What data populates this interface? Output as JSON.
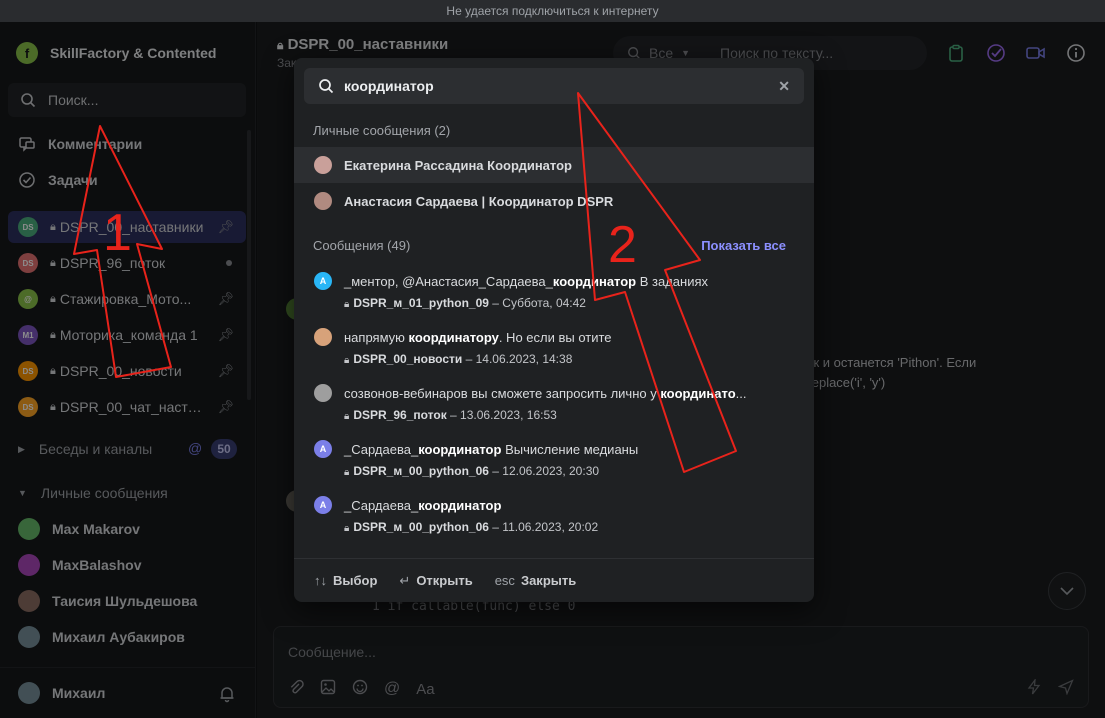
{
  "banner": "Не удается подключиться к интернету",
  "workspace": {
    "name": "SkillFactory & Contented"
  },
  "sidebar": {
    "search_placeholder": "Поиск...",
    "nav": [
      {
        "label": "Комментарии",
        "icon": "comments-icon"
      },
      {
        "label": "Задачи",
        "icon": "tasks-icon"
      }
    ],
    "channels": [
      {
        "label": "DSPR_00_наставники",
        "avatar": "DS",
        "color": "#4caf7f",
        "marker": "pin",
        "active": true
      },
      {
        "label": "DSPR_96_поток",
        "avatar": "DS",
        "color": "#e57373",
        "marker": "dot",
        "active": false
      },
      {
        "label": "Стажировка_Мото...",
        "avatar": "@",
        "color": "#8bc34a",
        "marker": "pin",
        "active": false
      },
      {
        "label": "Моторика_команда 1",
        "avatar": "M1",
        "color": "#7e57c2",
        "marker": "pin",
        "active": false
      },
      {
        "label": "DSPR_00_новости",
        "avatar": "DS",
        "color": "#ff9800",
        "marker": "pin",
        "active": false
      },
      {
        "label": "DSPR_00_чат_наста...",
        "avatar": "DS",
        "color": "#ffa726",
        "marker": "pin",
        "active": false
      }
    ],
    "sections": {
      "groups": "Беседы и каналы",
      "groups_count": "50",
      "direct": "Личные сообщения"
    },
    "users": [
      {
        "name": "Max Makarov",
        "color": "#66bb6a"
      },
      {
        "name": "MaxBalashov",
        "color": "#ab47bc"
      },
      {
        "name": "Таисия Шульдешова",
        "color": "#8d6e63"
      },
      {
        "name": "Михаил Аубакиров",
        "color": "#78909c"
      }
    ],
    "current_user": "Михаил"
  },
  "chat": {
    "title": "DSPR_00_наставники",
    "subtitle": "Зак",
    "filter": "Все",
    "search_placeholder": "Поиск по тексту...",
    "bg_line1": "кт так и останется 'Pithon'. Если",
    "bg_line2": "ord.replace('i', 'y')",
    "code": "1 if callable(func) else 0",
    "composer_placeholder": "Сообщение...",
    "composer_tools": [
      "attach-icon",
      "image-icon",
      "emoji-icon",
      "mention-icon",
      "Aa"
    ]
  },
  "search_modal": {
    "query": "координатор",
    "people_header": "Личные сообщения (2)",
    "people": [
      {
        "name": "Екатерина Рассадина Координатор",
        "color": "#c9a09a"
      },
      {
        "name": "Анастасия Сардаева | Координатор DSPR",
        "color": "#b08a80"
      }
    ],
    "messages_header": "Сообщения (49)",
    "show_all": "Показать все",
    "messages": [
      {
        "avatar": "A",
        "color": "#29b6f6",
        "pre": "_ментор, @Анастасия_Сардаева_",
        "hit": "координатор",
        "post": " В заданиях",
        "channel": "DSPR_м_01_python_09",
        "time": " – Суббота, 04:42"
      },
      {
        "avatar": "",
        "color": "#d7a27a",
        "pre": "напрямую ",
        "hit": "координатору",
        "post": ". Но если вы отите",
        "channel": "DSPR_00_новости",
        "time": " – 14.06.2023, 14:38"
      },
      {
        "avatar": "",
        "color": "#9e9e9e",
        "pre": "созвонов-вебинаров вы сможете запросить лично у ",
        "hit": "координато",
        "post": "...",
        "channel": "DSPR_96_поток",
        "time": " – 13.06.2023, 16:53"
      },
      {
        "avatar": "A",
        "color": "#7b7fe8",
        "pre": "_Сардаева_",
        "hit": "координатор",
        "post": " Вычисление медианы",
        "channel": "DSPR_м_00_python_06",
        "time": " – 12.06.2023, 20:30"
      },
      {
        "avatar": "A",
        "color": "#7b7fe8",
        "pre": "_Сардаева_",
        "hit": "координатор",
        "post": "",
        "channel": "DSPR_м_00_python_06",
        "time": " – 11.06.2023, 20:02"
      }
    ],
    "footer": [
      {
        "key": "↑↓",
        "label": "Выбор"
      },
      {
        "key": "↵",
        "label": "Открыть"
      },
      {
        "key": "esc",
        "label": "Закрыть"
      }
    ]
  },
  "annotations": {
    "n1": "1",
    "n2": "2",
    "color": "#e8231b"
  }
}
